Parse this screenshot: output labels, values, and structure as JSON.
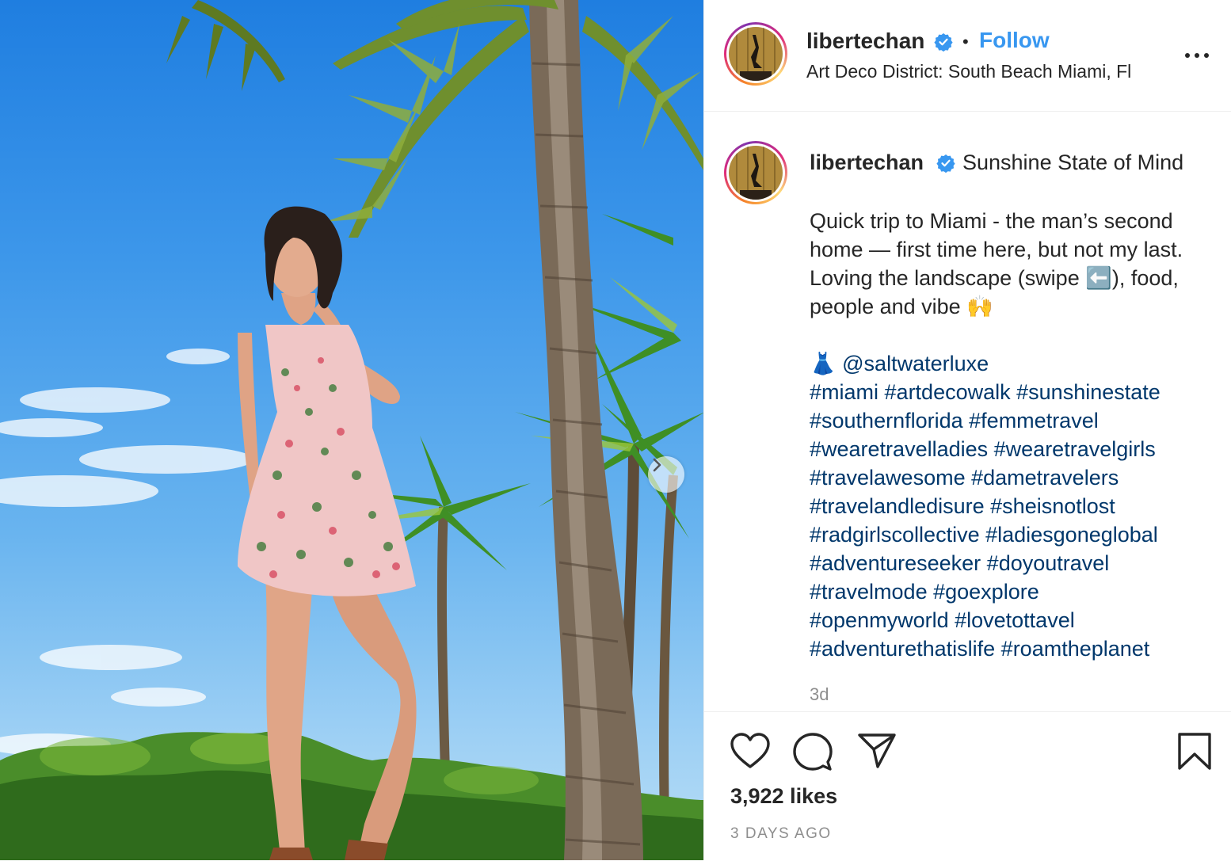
{
  "post": {
    "username": "libertechan",
    "separator": "•",
    "follow_label": "Follow",
    "location": "Art Deco District: South Beach Miami, Fl"
  },
  "caption": {
    "username": "libertechan",
    "title": "Sunshine State of Mind",
    "body_lines": [
      "Quick trip to Miami - the man’s second",
      "home — first time here, but not my last.",
      "Loving the landscape (swipe ⬅️), food,",
      "people and vibe 🙌"
    ],
    "mention_emoji": "👗",
    "mention": "@saltwaterluxe",
    "hashtag_lines": [
      [
        "#miami",
        "#artdecowalk",
        "#sunshinestate"
      ],
      [
        "#southernflorida",
        "#femmetravel"
      ],
      [
        "#wearetravelladies",
        "#wearetravelgirls"
      ],
      [
        "#travelawesome",
        "#dametravelers"
      ],
      [
        "#travelandledisure",
        "#sheisnotlost"
      ],
      [
        "#radgirlscollective",
        "#ladiesgoneglobal"
      ],
      [
        "#adventureseeker",
        "#doyoutravel"
      ],
      [
        "#travelmode",
        "#goexplore"
      ],
      [
        "#openmyworld",
        "#lovetottavel"
      ],
      [
        "#adventurethatislife",
        "#roamtheplanet"
      ]
    ],
    "time_short": "3d"
  },
  "footer": {
    "likes": "3,922 likes",
    "time_ago": "3 DAYS AGO"
  },
  "icons": {
    "verified": "verified-badge-icon",
    "more": "more-options-icon",
    "next": "chevron-right-icon",
    "like": "heart-icon",
    "comment": "comment-bubble-icon",
    "share": "paper-plane-icon",
    "save": "bookmark-icon"
  },
  "colors": {
    "link": "#3897f0",
    "hashtag": "#00376b",
    "muted": "#8e8e8e",
    "verified": "#3897f0"
  }
}
